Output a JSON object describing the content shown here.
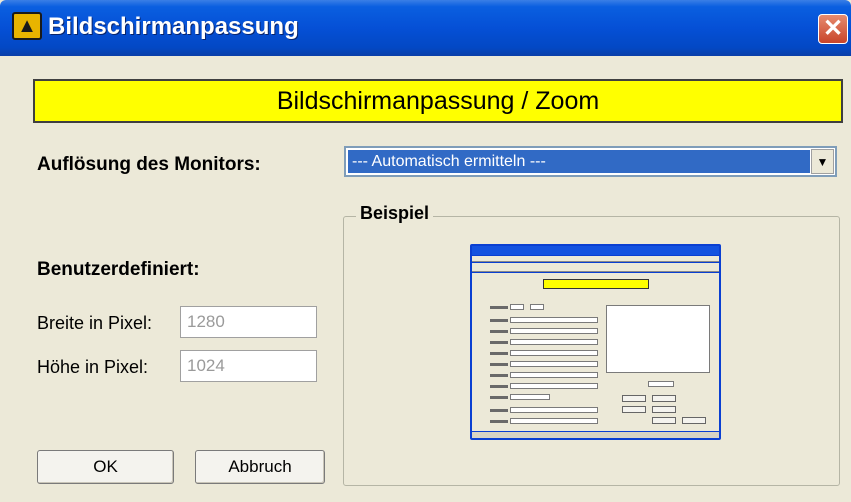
{
  "window": {
    "title": "Bildschirmanpassung",
    "close_glyph": "✕"
  },
  "banner": {
    "text": "Bildschirmanpassung / Zoom",
    "color": "#ffff00"
  },
  "resolution": {
    "label": "Auflösung des Monitors:",
    "selected": "--- Automatisch ermitteln ---",
    "arrow_glyph": "▼"
  },
  "custom": {
    "heading": "Benutzerdefiniert:",
    "width_label": "Breite in Pixel:",
    "width_value": "1280",
    "height_label": "Höhe in Pixel:",
    "height_value": "1024"
  },
  "example": {
    "legend": "Beispiel"
  },
  "buttons": {
    "ok": "OK",
    "cancel": "Abbruch"
  },
  "colors": {
    "titlebar": "#0550d6",
    "selection": "#316ac5",
    "dialog_bg": "#ece9d8"
  }
}
